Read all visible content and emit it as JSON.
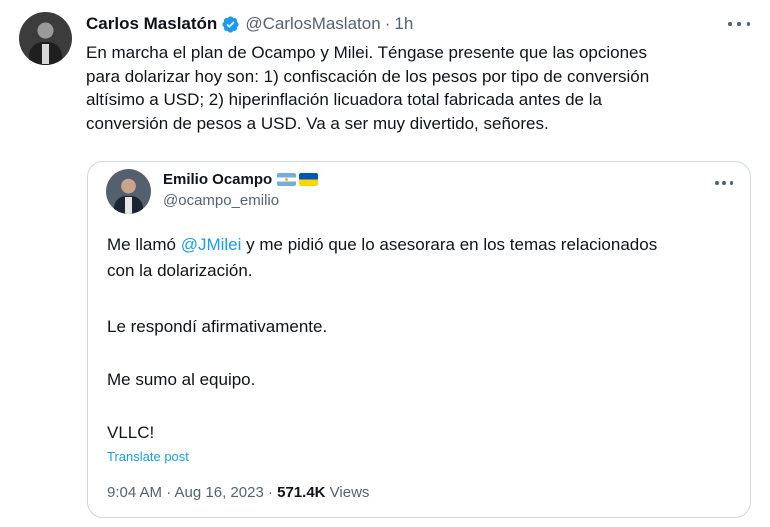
{
  "tweet": {
    "author_name": "Carlos Maslatón",
    "handle": "@CarlosMaslaton",
    "separator": "·",
    "time": "1h",
    "text_lines": [
      "En marcha el plan de Ocampo y Milei. Téngase presente que las opciones",
      "para dolarizar hoy son: 1) confiscación de los pesos por tipo de conversión",
      "altísimo a USD; 2) hiperinflación licuadora total fabricada antes de la",
      "conversión de pesos a USD. Va a ser muy divertido, señores."
    ],
    "icons": {
      "verified": "verified-badge-icon",
      "more": "more-options-icon"
    },
    "accent_color": "#1d9bf0"
  },
  "quote": {
    "author_name": "Emilio Ocampo",
    "handle": "@ocampo_emilio",
    "flags": [
      "argentina-flag-icon",
      "ukraine-flag-icon"
    ],
    "para1_before": "Me llamó ",
    "para1_mention": "@JMilei",
    "para1_after": " y me pidió que lo asesorara en los temas relacionados",
    "para1_line2": "con la dolarización.",
    "para2": "Le respondí afirmativamente.",
    "para3": "Me sumo al equipo.",
    "para4": "VLLC!",
    "translate_label": "Translate post",
    "timestamp": "9:04 AM · Aug 16, 2023 · ",
    "views_count": "571.4K",
    "views_label": " Views"
  }
}
